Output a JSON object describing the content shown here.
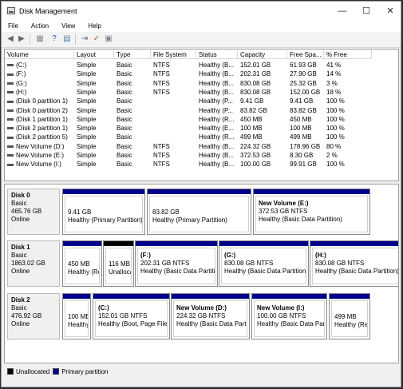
{
  "window": {
    "title": "Disk Management",
    "minimize": "—",
    "maximize": "☐",
    "close": "✕"
  },
  "menu": [
    "File",
    "Action",
    "View",
    "Help"
  ],
  "toolbar": [
    "back-icon",
    "forward-icon",
    "properties-icon",
    "help-icon",
    "connect-icon",
    "check-icon",
    "settings-icon"
  ],
  "volume_list": {
    "headers": [
      "Volume",
      "Layout",
      "Type",
      "File System",
      "Status",
      "Capacity",
      "Free Spa...",
      "% Free"
    ],
    "rows": [
      [
        "(C:)",
        "Simple",
        "Basic",
        "NTFS",
        "Healthy (B...",
        "152.01 GB",
        "61.93 GB",
        "41 %"
      ],
      [
        "(F:)",
        "Simple",
        "Basic",
        "NTFS",
        "Healthy (B...",
        "202.31 GB",
        "27.90 GB",
        "14 %"
      ],
      [
        "(G:)",
        "Simple",
        "Basic",
        "NTFS",
        "Healthy (B...",
        "830.08 GB",
        "25.32 GB",
        "3 %"
      ],
      [
        "(H:)",
        "Simple",
        "Basic",
        "NTFS",
        "Healthy (B...",
        "830.08 GB",
        "152.00 GB",
        "18 %"
      ],
      [
        "(Disk 0 partition 1)",
        "Simple",
        "Basic",
        "",
        "Healthy (P...",
        "9.41 GB",
        "9.41 GB",
        "100 %"
      ],
      [
        "(Disk 0 partition 2)",
        "Simple",
        "Basic",
        "",
        "Healthy (P...",
        "83.82 GB",
        "83.82 GB",
        "100 %"
      ],
      [
        "(Disk 1 partition 1)",
        "Simple",
        "Basic",
        "",
        "Healthy (R...",
        "450 MB",
        "450 MB",
        "100 %"
      ],
      [
        "(Disk 2 partition 1)",
        "Simple",
        "Basic",
        "",
        "Healthy (E...",
        "100 MB",
        "100 MB",
        "100 %"
      ],
      [
        "(Disk 2 partition 5)",
        "Simple",
        "Basic",
        "",
        "Healthy (R...",
        "499 MB",
        "499 MB",
        "100 %"
      ],
      [
        "New Volume (D:)",
        "Simple",
        "Basic",
        "NTFS",
        "Healthy (B...",
        "224.32 GB",
        "178.96 GB",
        "80 %"
      ],
      [
        "New Volume (E:)",
        "Simple",
        "Basic",
        "NTFS",
        "Healthy (B...",
        "372.53 GB",
        "8.30 GB",
        "2 %"
      ],
      [
        "New Volume (I:)",
        "Simple",
        "Basic",
        "NTFS",
        "Healthy (B...",
        "100.00 GB",
        "99.91 GB",
        "100 %"
      ]
    ]
  },
  "disks": [
    {
      "name": "Disk 0",
      "type": "Basic",
      "size": "465.76 GB",
      "status": "Online",
      "partitions": [
        {
          "name": "",
          "line1": "9.41 GB",
          "line2": "Healthy (Primary Partition)",
          "unalloc": false
        },
        {
          "name": "",
          "line1": "83.82 GB",
          "line2": "Healthy (Primary Partition)",
          "unalloc": false
        },
        {
          "name": "New Volume  (E:)",
          "line1": "372.53 GB NTFS",
          "line2": "Healthy (Basic Data Partition)",
          "unalloc": false
        }
      ]
    },
    {
      "name": "Disk 1",
      "type": "Basic",
      "size": "1863.02 GB",
      "status": "Online",
      "partitions": [
        {
          "name": "",
          "line1": "450 MB",
          "line2": "Healthy (Re",
          "unalloc": false
        },
        {
          "name": "",
          "line1": "116 MB",
          "line2": "Unalloca",
          "unalloc": true
        },
        {
          "name": "(F:)",
          "line1": "202.31 GB NTFS",
          "line2": "Healthy (Basic Data Partitio",
          "unalloc": false
        },
        {
          "name": "(G:)",
          "line1": "830.08 GB NTFS",
          "line2": "Healthy (Basic Data Partition)",
          "unalloc": false
        },
        {
          "name": "(H:)",
          "line1": "830.08 GB NTFS",
          "line2": "Healthy (Basic Data Partition)",
          "unalloc": false
        }
      ]
    },
    {
      "name": "Disk 2",
      "type": "Basic",
      "size": "476.92 GB",
      "status": "Online",
      "partitions": [
        {
          "name": "",
          "line1": "100 MB",
          "line2": "Healthy",
          "unalloc": false
        },
        {
          "name": "(C:)",
          "line1": "152.01 GB NTFS",
          "line2": "Healthy (Boot, Page File,",
          "unalloc": false
        },
        {
          "name": "New Volume  (D:)",
          "line1": "224.32 GB NTFS",
          "line2": "Healthy (Basic Data Partiti",
          "unalloc": false
        },
        {
          "name": "New Volume  (I:)",
          "line1": "100.00 GB NTFS",
          "line2": "Healthy (Basic Data Part",
          "unalloc": false
        },
        {
          "name": "",
          "line1": "499 MB",
          "line2": "Healthy (Re",
          "unalloc": false
        }
      ]
    }
  ],
  "legend": {
    "unallocated": "Unallocated",
    "primary": "Primary partition"
  },
  "colors": {
    "primary": "#00008b",
    "unallocated": "#000000"
  }
}
